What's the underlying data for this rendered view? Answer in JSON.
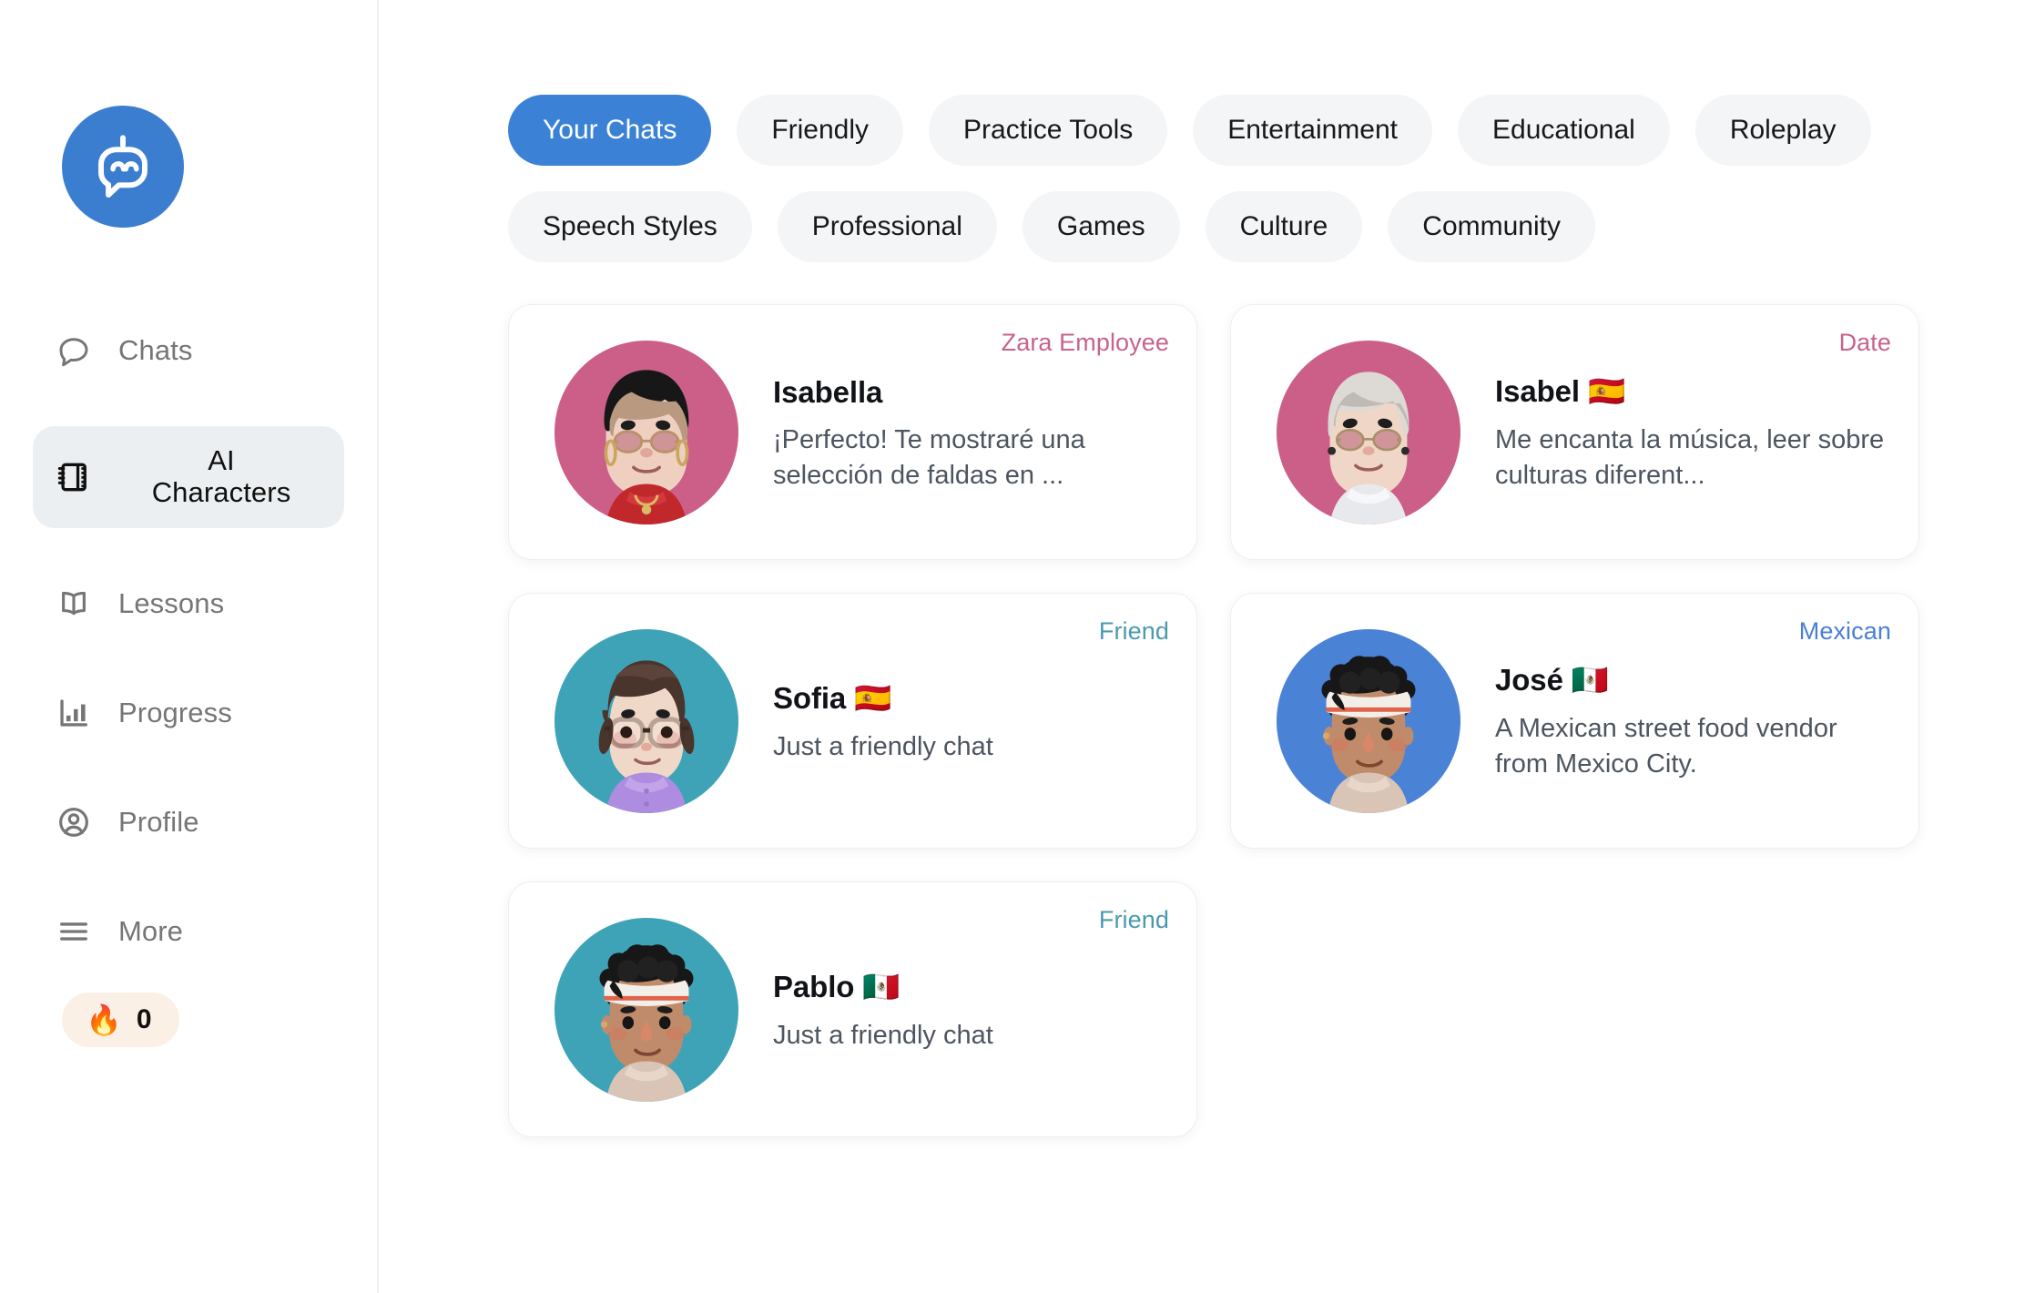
{
  "sidebar": {
    "logo": {
      "icon": "chatbot-logo-icon",
      "color": "#3b7ed0"
    },
    "items": [
      {
        "label": "Chats",
        "icon": "chat-bubble-icon",
        "active": false
      },
      {
        "label": "AI\nCharacters",
        "icon": "ai-characters-icon",
        "active": true
      },
      {
        "label": "Lessons",
        "icon": "open-book-icon",
        "active": false
      },
      {
        "label": "Progress",
        "icon": "bar-chart-icon",
        "active": false
      },
      {
        "label": "Profile",
        "icon": "user-circle-icon",
        "active": false
      },
      {
        "label": "More",
        "icon": "hamburger-menu-icon",
        "active": false
      }
    ],
    "streak": {
      "icon": "flame-icon",
      "emoji": "🔥",
      "count": "0"
    }
  },
  "filters": {
    "selected": "Your Chats",
    "pills": [
      "Your Chats",
      "Friendly",
      "Practice Tools",
      "Entertainment",
      "Educational",
      "Roleplay",
      "Speech Styles",
      "Professional",
      "Games",
      "Culture",
      "Community"
    ]
  },
  "characters": [
    {
      "name": "Isabella",
      "subtitle": "¡Perfecto! Te mostraré una selección de faldas en ...",
      "tag": "Zara Employee",
      "tag_color": "#c8638a",
      "avatar": "isabella-avatar",
      "avatar_bg": "#cc5f88"
    },
    {
      "name": "Isabel 🇪🇸",
      "subtitle": "Me encanta la música, leer sobre culturas diferent...",
      "tag": "Date",
      "tag_color": "#c8638a",
      "avatar": "isabel-avatar",
      "avatar_bg": "#cc5f88"
    },
    {
      "name": "Sofia 🇪🇸",
      "subtitle": "Just a friendly chat",
      "tag": "Friend",
      "tag_color": "#4a9aaf",
      "avatar": "sofia-avatar",
      "avatar_bg": "#3fa3b8"
    },
    {
      "name": "José 🇲🇽",
      "subtitle": "A Mexican street food vendor from Mexico City.",
      "tag": "Mexican",
      "tag_color": "#4a7fd4",
      "avatar": "jose-avatar",
      "avatar_bg": "#4a82d6"
    },
    {
      "name": "Pablo 🇲🇽",
      "subtitle": "Just a friendly chat",
      "tag": "Friend",
      "tag_color": "#4a9aaf",
      "avatar": "pablo-avatar",
      "avatar_bg": "#3fa3b8"
    }
  ]
}
